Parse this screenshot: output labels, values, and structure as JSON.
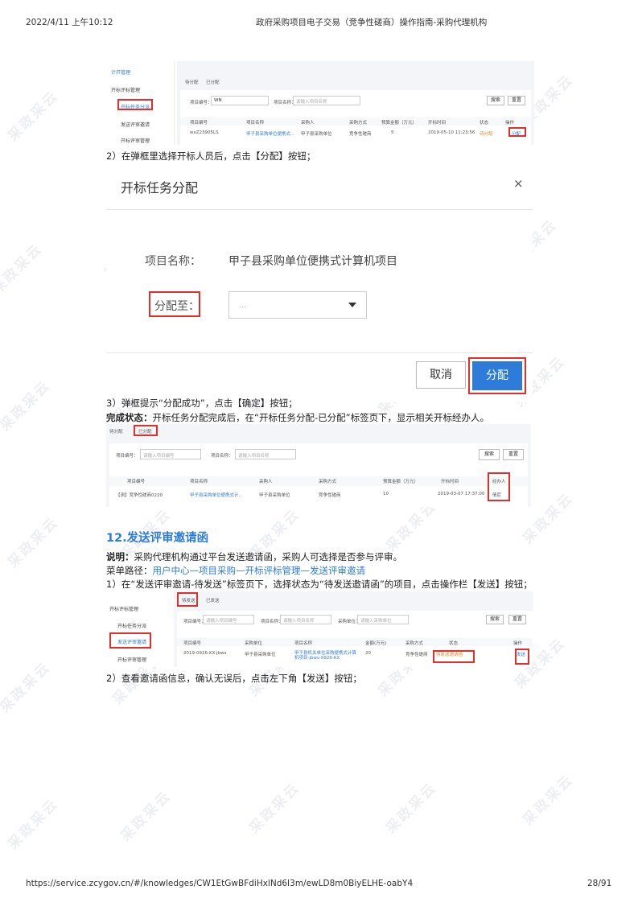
{
  "header": {
    "left": "2022/4/11 上午10:12",
    "center": "政府采购项目电子交易（竞争性磋商）操作指南-采购代理机构"
  },
  "footer": {
    "url": "https://service.zcygov.cn/#/knowledges/CW1EtGwBFdiHxlNd6I3m/ewLD8m0BiyELHE-oabY4",
    "page": "28/91"
  },
  "watermark": "采政采云",
  "shot1": {
    "sidebar": [
      "计开管理",
      "开标评标管理",
      "开标任务分派",
      "发送评审邀请",
      "开标评审管理"
    ],
    "tabs": [
      "待分配",
      "已分配"
    ],
    "search": {
      "code_label": "项目编号：",
      "code_value": "WN",
      "name_label": "项目名称：",
      "name_placeholder": "请输入项目名称",
      "search_btn": "搜索",
      "reset_btn": "重置"
    },
    "columns": [
      "项目编号",
      "项目名称",
      "采购人",
      "采购方式",
      "预算金额（万元）",
      "开标时间",
      "状态",
      "操作"
    ],
    "row": [
      "wxZ23905LS",
      "甲子县采购单位便携式...",
      "甲子县采购单位",
      "竞争性磋商",
      "5",
      "2019-05-10 11:23:56",
      "待分配",
      "分配"
    ]
  },
  "step2": "2）在弹框里选择开标人员后，点击【分配】按钮；",
  "dialog": {
    "title": "开标任务分配",
    "close": "×",
    "name_label": "项目名称：",
    "name_value": "甲子县采购单位便携式计算机项目",
    "assign_label": "分配至：",
    "assign_value": "...",
    "cancel": "取消",
    "confirm": "分配"
  },
  "step3": "3）弹框提示“分配成功”，点击【确定】按钮；",
  "done": {
    "label": "完成状态：",
    "text": "开标任务分配完成后，在“开标任务分配-已分配”标签页下，显示相关开标经办人。"
  },
  "shot2": {
    "tabs": [
      "待分配",
      "已分配"
    ],
    "search": {
      "code_label": "项目编号：",
      "code_placeholder": "请输入项目编号",
      "name_label": "项目名称：",
      "name_placeholder": "请输入项目名称",
      "search_btn": "搜索",
      "reset_btn": "重置"
    },
    "columns": [
      "项目编号",
      "项目名称",
      "采购人",
      "采购方式",
      "预算金额（万元）",
      "开标时间",
      "经办人"
    ],
    "row": [
      "【测】竞争性磋商0220",
      "甲子县采购单位便携式计...",
      "甲子县采购单位",
      "竞争性磋商",
      "10",
      "2019-03-07 17:37:00",
      "倩尼"
    ]
  },
  "section": {
    "title": "12.发送评审邀请函"
  },
  "desc": {
    "label": "说明：",
    "text": "采购代理机构通过平台发送邀请函，采购人可选择是否参与评审。"
  },
  "menu": {
    "label": "菜单路径：",
    "path": "用户中心—项目采购—开标评标管理—发送评审邀请"
  },
  "step4": "1）在“发送评审邀请-待发送”标签页下，选择状态为“待发送邀请函”的项目，点击操作栏【发送】按钮；",
  "shot3": {
    "sidebar": [
      "开标评标管理",
      "开标任务分派",
      "发送评审邀请",
      "开标评审管理"
    ],
    "tabs": [
      "待发送",
      "已发送"
    ],
    "search": {
      "code_label": "项目编号：",
      "code_placeholder": "请输入项目编号",
      "name_label": "项目名称：",
      "name_placeholder": "请输入项目名称",
      "buyer_label": "采购单位：",
      "buyer_placeholder": "请输入采购单位",
      "search_btn": "搜索",
      "reset_btn": "重置"
    },
    "columns": [
      "项目编号",
      "采购单位",
      "项目名称",
      "金额(万元)",
      "采购方式",
      "状态",
      "操作"
    ],
    "row": [
      "2019-0926-KX-jbws",
      "甲子县采购单位",
      "甲子县机关单位采购便携式计算机项目-jbws-0926-KX",
      "20",
      "竞争性磋商",
      "待发送邀请函",
      "发送"
    ]
  },
  "step5": "2）查看邀请函信息，确认无误后，点击左下角【发送】按钮；"
}
